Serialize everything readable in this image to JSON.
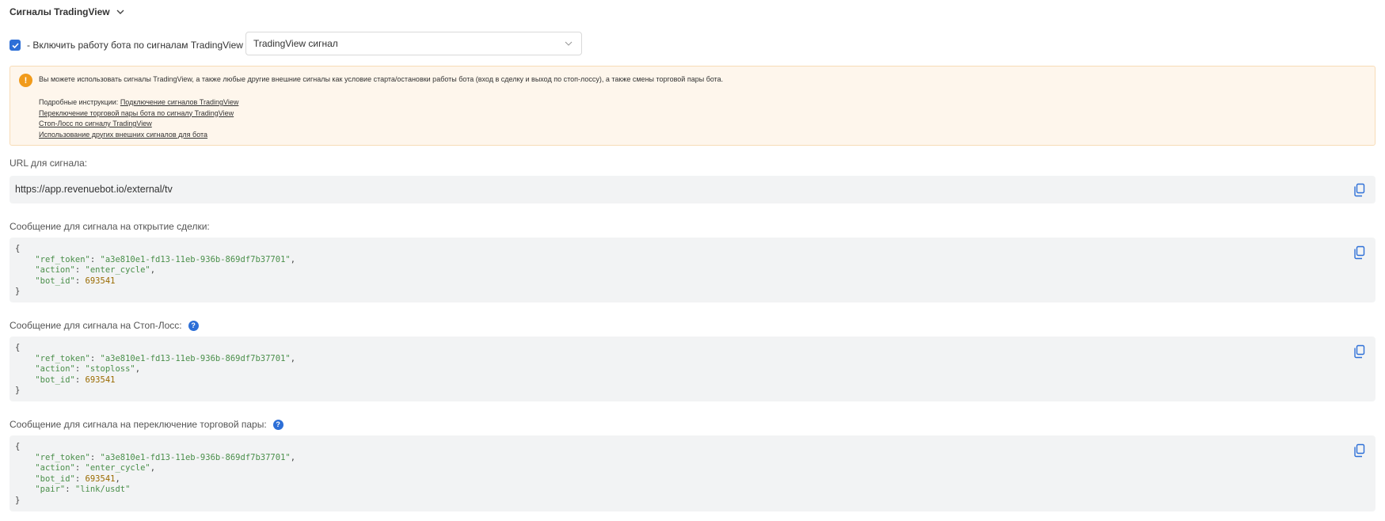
{
  "section": {
    "title": "Сигналы TradingView"
  },
  "enable": {
    "checked": true,
    "label": "- Включить работу бота по сигналам TradingView"
  },
  "signal_select": {
    "value": "TradingView сигнал"
  },
  "alert": {
    "text": "Вы можете использовать сигналы TradingView, а также любые другие внешние сигналы как условие старта/остановки работы бота (вход в сделку и выход по стоп-лоссу), а также смены торговой пары бота.",
    "instructions_prefix": "Подробные инструкции:",
    "links": [
      "Подключение сигналов TradingView",
      "Переключение торговой пары бота по сигналу TradingView",
      "Стоп-Лосс по сигналу TradingView",
      "Использование других внешних сигналов для бота"
    ]
  },
  "url": {
    "label": "URL для сигнала:",
    "value": "https://app.revenuebot.io/external/tv"
  },
  "messages": [
    {
      "label": "Сообщение для сигнала на открытие сделки:",
      "has_help": false,
      "fields": [
        {
          "key": "\"ref_token\"",
          "value": "\"a3e810e1-fd13-11eb-936b-869df7b37701\"",
          "type": "string"
        },
        {
          "key": "\"action\"",
          "value": "\"enter_cycle\"",
          "type": "string"
        },
        {
          "key": "\"bot_id\"",
          "value": "693541",
          "type": "number"
        }
      ]
    },
    {
      "label": "Сообщение для сигнала на Стоп-Лосс:",
      "has_help": true,
      "fields": [
        {
          "key": "\"ref_token\"",
          "value": "\"a3e810e1-fd13-11eb-936b-869df7b37701\"",
          "type": "string"
        },
        {
          "key": "\"action\"",
          "value": "\"stoploss\"",
          "type": "string"
        },
        {
          "key": "\"bot_id\"",
          "value": "693541",
          "type": "number"
        }
      ]
    },
    {
      "label": "Сообщение для сигнала на переключение торговой пары:",
      "has_help": true,
      "fields": [
        {
          "key": "\"ref_token\"",
          "value": "\"a3e810e1-fd13-11eb-936b-869df7b37701\"",
          "type": "string"
        },
        {
          "key": "\"action\"",
          "value": "\"enter_cycle\"",
          "type": "string"
        },
        {
          "key": "\"bot_id\"",
          "value": "693541",
          "type": "number"
        },
        {
          "key": "\"pair\"",
          "value": "\"link/usdt\"",
          "type": "string"
        }
      ]
    }
  ],
  "colors": {
    "accent": "#2d6fd7",
    "warning": "#f19b1b",
    "alert_bg": "#fef6ec",
    "code_bg": "#f2f3f4"
  },
  "icons": {
    "copy": "copy-icon",
    "help": "help-icon",
    "warning": "warning-icon",
    "chevron": "chevron-down-icon"
  }
}
